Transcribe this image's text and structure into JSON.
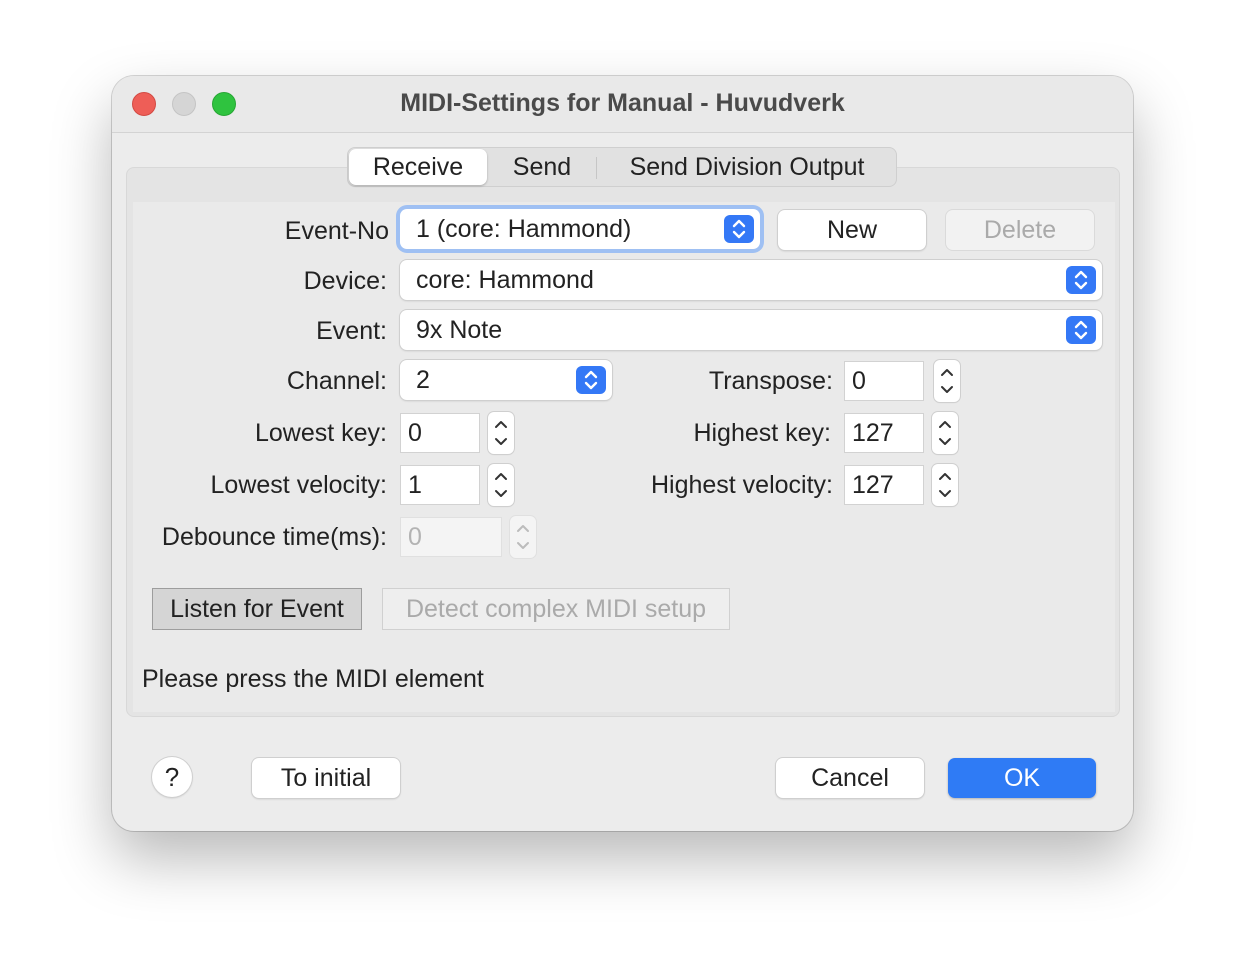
{
  "window": {
    "title": "MIDI-Settings for Manual - Huvudverk"
  },
  "tabs": [
    {
      "label": "Receive",
      "active": true
    },
    {
      "label": "Send",
      "active": false
    },
    {
      "label": "Send Division Output",
      "active": false
    }
  ],
  "form": {
    "event_no": {
      "label": "Event-No",
      "value": "1 (core: Hammond)"
    },
    "new_label": "New",
    "delete_label": "Delete",
    "device": {
      "label": "Device:",
      "value": "core: Hammond"
    },
    "event": {
      "label": "Event:",
      "value": "9x Note"
    },
    "channel": {
      "label": "Channel:",
      "value": "2"
    },
    "transpose": {
      "label": "Transpose:",
      "value": "0"
    },
    "lowest_key": {
      "label": "Lowest key:",
      "value": "0"
    },
    "highest_key": {
      "label": "Highest key:",
      "value": "127"
    },
    "lowest_velocity": {
      "label": "Lowest velocity:",
      "value": "1"
    },
    "highest_velocity": {
      "label": "Highest velocity:",
      "value": "127"
    },
    "debounce": {
      "label": "Debounce time(ms):",
      "value": "0"
    }
  },
  "actions": {
    "listen_label": "Listen for Event",
    "detect_label": "Detect complex MIDI setup",
    "status": "Please press the MIDI element"
  },
  "footer": {
    "help_label": "?",
    "to_initial_label": "To initial",
    "cancel_label": "Cancel",
    "ok_label": "OK"
  },
  "colors": {
    "accent": "#2f7bf5",
    "close": "#ee5e57",
    "maximize": "#2fc33f"
  }
}
